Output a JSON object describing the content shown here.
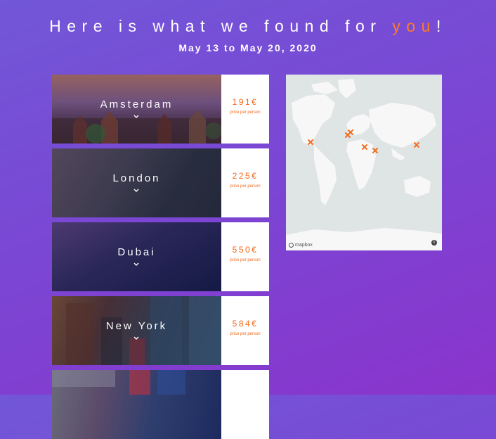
{
  "header": {
    "headline_prefix": "Here is what we found for ",
    "headline_accent": "you",
    "headline_suffix": "!",
    "date_range": "May 13 to May 20, 2020"
  },
  "results": [
    {
      "city": "Amsterdam",
      "price": "191€",
      "price_note": "price per person"
    },
    {
      "city": "London",
      "price": "225€",
      "price_note": "price per person"
    },
    {
      "city": "Dubai",
      "price": "550€",
      "price_note": "price per person"
    },
    {
      "city": "New York",
      "price": "584€",
      "price_note": "price per person"
    },
    {
      "city": "",
      "price": "",
      "price_note": ""
    }
  ],
  "map": {
    "attribution": "mapbox",
    "info_label": "i",
    "marker_icon": "airplane-icon",
    "marker_color": "#f26a1b"
  },
  "colors": {
    "accent": "#ff7a2a",
    "price": "#f26a1b",
    "background_start": "#7257d8",
    "background_end": "#8a34cc"
  }
}
